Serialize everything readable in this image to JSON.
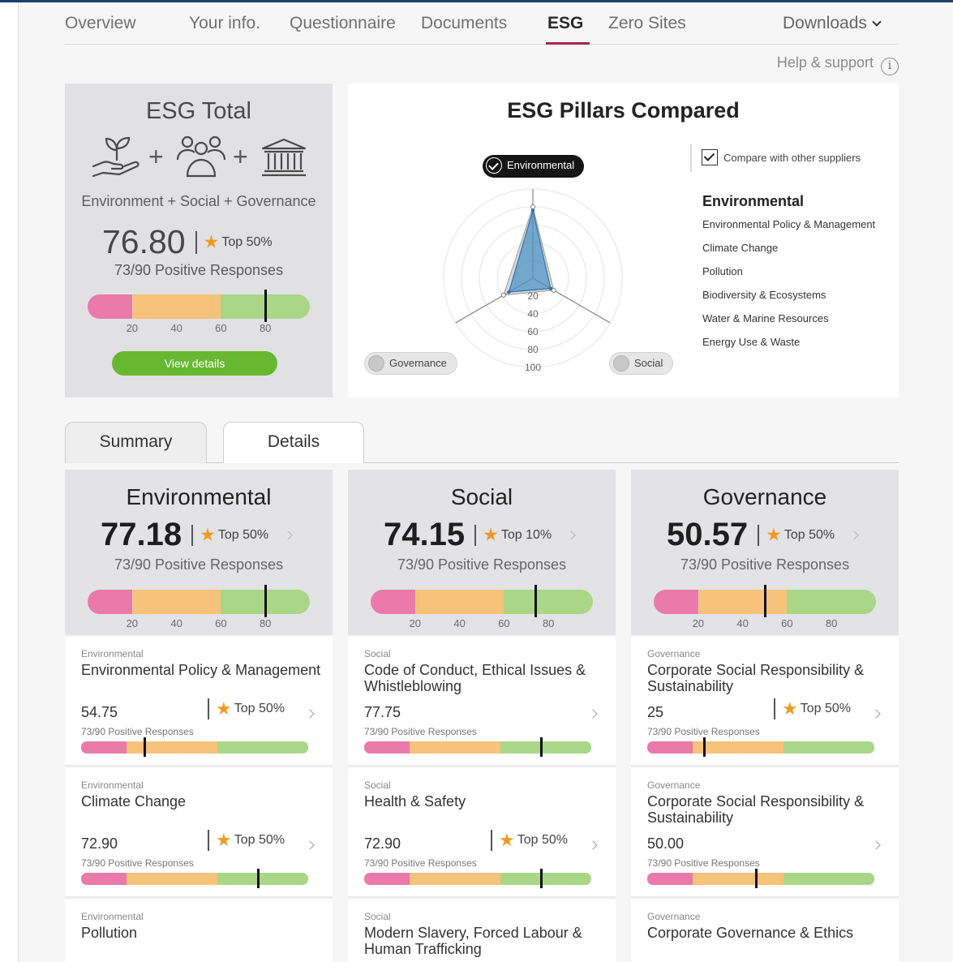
{
  "nav": {
    "items": [
      "Overview",
      "Your info.",
      "Questionnaire",
      "Documents",
      "ESG",
      "Zero Sites"
    ],
    "active": "ESG",
    "downloads": "Downloads",
    "help": "Help & support"
  },
  "total": {
    "title": "ESG Total",
    "pillars_text": "Environment + Social + Governance",
    "score": "76.80",
    "rank": "Top 50%",
    "responses": "73/90 Positive Responses",
    "bar_value": 80,
    "ticks": [
      "20",
      "40",
      "60",
      "80"
    ],
    "button": "View details"
  },
  "compared": {
    "title": "ESG Pillars Compared",
    "axes": [
      "Environmental",
      "Governance",
      "Social"
    ],
    "scale": [
      "20",
      "40",
      "60",
      "80",
      "100"
    ],
    "supplier_values": [
      76,
      31,
      23
    ],
    "comparison_values": [
      80,
      38,
      27
    ],
    "compare_label": "Compare with other suppliers",
    "compare_checked": true,
    "legend_title": "Environmental",
    "legend_items": [
      "Environmental Policy & Management",
      "Climate Change",
      "Pollution",
      "Biodiversity & Ecosystems",
      "Water & Marine Resources",
      "Energy Use & Waste"
    ]
  },
  "tabs": [
    "Summary",
    "Details"
  ],
  "pillars": [
    {
      "name": "Environmental",
      "score": "77.18",
      "rank": "Top 50%",
      "responses": "73/90 Positive Responses",
      "bar_value": 80,
      "ticks": [
        "20",
        "40",
        "60",
        "80"
      ],
      "subs": [
        {
          "category": "Environmental",
          "title": "Environmental Policy & Management",
          "score": "54.75",
          "rank": "Top 50%",
          "responses": "73/90 Positive Responses",
          "bar_value": 28
        },
        {
          "category": "Environmental",
          "title": "Climate Change",
          "score": "72.90",
          "rank": "Top 50%",
          "responses": "73/90 Positive Responses",
          "bar_value": 78
        },
        {
          "category": "Environmental",
          "title": "Pollution"
        }
      ]
    },
    {
      "name": "Social",
      "score": "74.15",
      "rank": "Top 10%",
      "responses": "73/90 Positive Responses",
      "bar_value": 74,
      "ticks": [
        "20",
        "40",
        "60",
        "80"
      ],
      "subs": [
        {
          "category": "Social",
          "title": "Code of Conduct, Ethical Issues & Whistleblowing",
          "score": "77.75",
          "rank": "",
          "responses": "73/90 Positive Responses",
          "bar_value": 78
        },
        {
          "category": "Social",
          "title": "Health & Safety",
          "score": "72.90",
          "rank": "Top 50%",
          "responses": "73/90 Positive Responses",
          "bar_value": 78
        },
        {
          "category": "Social",
          "title": "Modern Slavery, Forced Labour & Human Trafficking"
        }
      ]
    },
    {
      "name": "Governance",
      "score": "50.57",
      "rank": "Top 50%",
      "responses": "73/90 Positive Responses",
      "bar_value": 50,
      "ticks": [
        "20",
        "40",
        "60",
        "80"
      ],
      "subs": [
        {
          "category": "Governance",
          "title": "Corporate Social Responsibility & Sustainability",
          "score": "25",
          "rank": "Top 50%",
          "responses": "73/90 Positive Responses",
          "bar_value": 25
        },
        {
          "category": "Governance",
          "title": "Corporate Social Responsibility & Sustainability",
          "score": "50.00",
          "rank": "",
          "responses": "73/90 Positive Responses",
          "bar_value": 48
        },
        {
          "category": "Governance",
          "title": "Corporate Governance & Ethics"
        }
      ]
    }
  ]
}
